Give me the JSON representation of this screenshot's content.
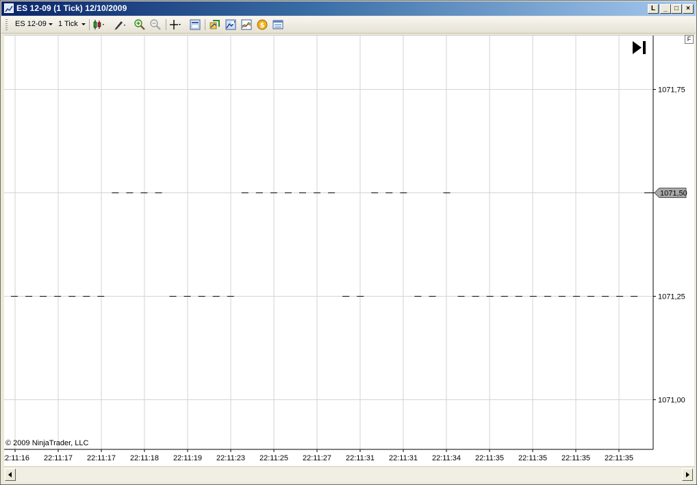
{
  "window": {
    "title": "ES 12-09 (1 Tick)  12/10/2009",
    "buttons": {
      "link": "L",
      "minimize": "_",
      "maximize": "□",
      "close": "×"
    }
  },
  "toolbar": {
    "instrument": "ES 12-09",
    "interval": "1 Tick",
    "icons": [
      "candlestick-style-icon",
      "drawing-tools-icon",
      "zoom-in-icon",
      "zoom-out-icon",
      "crosshair-icon",
      "properties-icon",
      "indicators-icon",
      "strategies-icon",
      "chart-trader-icon",
      "order-icon",
      "data-box-icon"
    ]
  },
  "chart": {
    "fullscreen_label": "F",
    "copyright": "© 2009 NinjaTrader, LLC",
    "current_price_label": "1071,50",
    "scroll_end_icon": "scroll-to-end-icon",
    "colors": {
      "bar": "#000000",
      "grid": "#d3d3d3",
      "price_marker": "#a9a9a9"
    }
  },
  "chart_data": {
    "type": "line",
    "title": "ES 12-09 (1 Tick)",
    "y_ticks": [
      "1071,75",
      "1071,50",
      "1071,25",
      "1071,00"
    ],
    "x_tick_labels": [
      "22:11:16",
      "22:11:17",
      "22:11:17",
      "22:11:18",
      "22:11:19",
      "22:11:23",
      "22:11:25",
      "22:11:27",
      "22:11:31",
      "22:11:31",
      "22:11:34",
      "22:11:35",
      "22:11:35",
      "22:11:35",
      "22:11:35"
    ],
    "ylim": [
      1070.88,
      1071.88
    ],
    "grid": true,
    "ticks": [
      1071.25,
      1071.25,
      1071.25,
      1071.25,
      1071.25,
      1071.25,
      1071.25,
      1071.5,
      1071.5,
      1071.5,
      1071.5,
      1071.25,
      1071.25,
      1071.25,
      1071.25,
      1071.25,
      1071.5,
      1071.5,
      1071.5,
      1071.5,
      1071.5,
      1071.5,
      1071.5,
      1071.25,
      1071.25,
      1071.5,
      1071.5,
      1071.5,
      1071.25,
      1071.25,
      1071.5,
      1071.25,
      1071.25,
      1071.25,
      1071.25,
      1071.25,
      1071.25,
      1071.25,
      1071.25,
      1071.25,
      1071.25,
      1071.25,
      1071.25,
      1071.25
    ],
    "last_price": 1071.5
  }
}
